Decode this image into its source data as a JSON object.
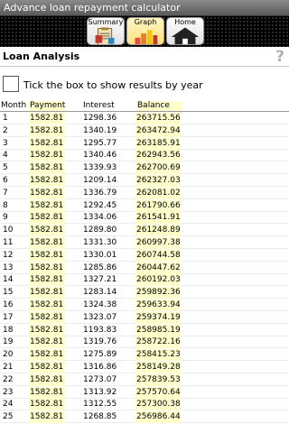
{
  "window": {
    "title": "Advance loan repayment calculator"
  },
  "toolbar": {
    "summary_label": "Summary",
    "graph_label": "Graph",
    "home_label": "Home",
    "summary_icon": "clipboard-icon",
    "graph_icon": "bar-chart-icon",
    "home_icon": "house-icon"
  },
  "header": {
    "title": "Loan Analysis",
    "help_icon": "?"
  },
  "options": {
    "year_checkbox_label": "Tick the box to show results by year",
    "year_checkbox_checked": false
  },
  "table": {
    "headers": {
      "month": "Month",
      "payment": "Payment",
      "interest": "Interest",
      "balance": "Balance"
    },
    "rows": [
      {
        "month": "1",
        "payment": "1582.81",
        "interest": "1298.36",
        "balance": "263715.56"
      },
      {
        "month": "2",
        "payment": "1582.81",
        "interest": "1340.19",
        "balance": "263472.94"
      },
      {
        "month": "3",
        "payment": "1582.81",
        "interest": "1295.77",
        "balance": "263185.91"
      },
      {
        "month": "4",
        "payment": "1582.81",
        "interest": "1340.46",
        "balance": "262943.56"
      },
      {
        "month": "5",
        "payment": "1582.81",
        "interest": "1339.93",
        "balance": "262700.69"
      },
      {
        "month": "6",
        "payment": "1582.81",
        "interest": "1209.14",
        "balance": "262327.03"
      },
      {
        "month": "7",
        "payment": "1582.81",
        "interest": "1336.79",
        "balance": "262081.02"
      },
      {
        "month": "8",
        "payment": "1582.81",
        "interest": "1292.45",
        "balance": "261790.66"
      },
      {
        "month": "9",
        "payment": "1582.81",
        "interest": "1334.06",
        "balance": "261541.91"
      },
      {
        "month": "10",
        "payment": "1582.81",
        "interest": "1289.80",
        "balance": "261248.89"
      },
      {
        "month": "11",
        "payment": "1582.81",
        "interest": "1331.30",
        "balance": "260997.38"
      },
      {
        "month": "12",
        "payment": "1582.81",
        "interest": "1330.01",
        "balance": "260744.58"
      },
      {
        "month": "13",
        "payment": "1582.81",
        "interest": "1285.86",
        "balance": "260447.62"
      },
      {
        "month": "14",
        "payment": "1582.81",
        "interest": "1327.21",
        "balance": "260192.03"
      },
      {
        "month": "15",
        "payment": "1582.81",
        "interest": "1283.14",
        "balance": "259892.36"
      },
      {
        "month": "16",
        "payment": "1582.81",
        "interest": "1324.38",
        "balance": "259633.94"
      },
      {
        "month": "17",
        "payment": "1582.81",
        "interest": "1323.07",
        "balance": "259374.19"
      },
      {
        "month": "18",
        "payment": "1582.81",
        "interest": "1193.83",
        "balance": "258985.19"
      },
      {
        "month": "19",
        "payment": "1582.81",
        "interest": "1319.76",
        "balance": "258722.16"
      },
      {
        "month": "20",
        "payment": "1582.81",
        "interest": "1275.89",
        "balance": "258415.23"
      },
      {
        "month": "21",
        "payment": "1582.81",
        "interest": "1316.86",
        "balance": "258149.28"
      },
      {
        "month": "22",
        "payment": "1582.81",
        "interest": "1273.07",
        "balance": "257839.53"
      },
      {
        "month": "23",
        "payment": "1582.81",
        "interest": "1313.92",
        "balance": "257570.64"
      },
      {
        "month": "24",
        "payment": "1582.81",
        "interest": "1312.55",
        "balance": "257300.38"
      },
      {
        "month": "25",
        "payment": "1582.81",
        "interest": "1268.85",
        "balance": "256986.44"
      }
    ]
  },
  "colors": {
    "highlight": "#ffffcc",
    "toolbar_bg": "#000000",
    "titlebar_bg": "#6e6e6e"
  }
}
